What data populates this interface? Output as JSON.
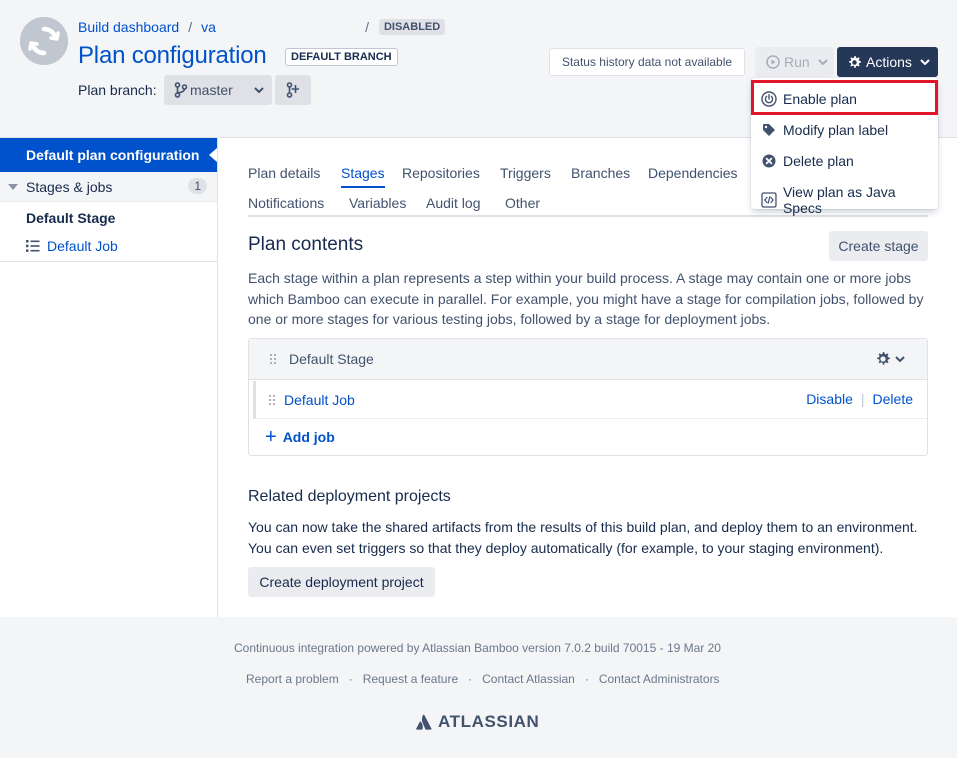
{
  "header": {
    "breadcrumb": [
      "Build dashboard",
      "va"
    ],
    "breadcrumb_sep": "/",
    "plan_status": "DISABLED",
    "title": "Plan configuration",
    "branch_badge": "DEFAULT BRANCH",
    "branch_label": "Plan branch:",
    "branch_value": "master",
    "status_history": "Status history data not available",
    "run_label": "Run",
    "actions_label": "Actions"
  },
  "actions_menu": {
    "items": [
      {
        "label": "Enable plan",
        "icon": "power-icon",
        "highlighted": true
      },
      {
        "label": "Modify plan label",
        "icon": "tag-icon"
      },
      {
        "label": "Delete plan",
        "icon": "x-circle-icon"
      },
      {
        "label": "View plan as Java Specs",
        "icon": "code-icon"
      }
    ],
    "highlight_color": "#e0152c"
  },
  "sidebar": {
    "active_item": "Default plan configuration",
    "group_label": "Stages & jobs",
    "group_count": "1",
    "stage_label": "Default Stage",
    "job_label": "Default Job"
  },
  "tabs": [
    {
      "label": "Plan details"
    },
    {
      "label": "Stages",
      "active": true
    },
    {
      "label": "Repositories"
    },
    {
      "label": "Triggers"
    },
    {
      "label": "Branches"
    },
    {
      "label": "Dependencies"
    },
    {
      "label": "Notifications"
    },
    {
      "label": "Variables"
    },
    {
      "label": "Audit log"
    },
    {
      "label": "Other"
    }
  ],
  "plan_contents": {
    "title": "Plan contents",
    "create_stage": "Create stage",
    "description": "Each stage within a plan represents a step within your build process. A stage may contain one or more jobs which Bamboo can execute in parallel. For example, you might have a stage for compilation jobs, followed by one or more stages for various testing jobs, followed by a stage for deployment jobs.",
    "stage_name": "Default Stage",
    "job_name": "Default Job",
    "disable_label": "Disable",
    "delete_label": "Delete",
    "add_job": "Add job"
  },
  "related": {
    "title": "Related deployment projects",
    "description": "You can now take the shared artifacts from the results of this build plan, and deploy them to an environment. You can even set triggers so that they deploy automatically (for example, to your staging environment).",
    "button": "Create deployment project"
  },
  "footer": {
    "powered_by": "Continuous integration powered by Atlassian Bamboo version 7.0.2 build 70015 - 19 Mar 20",
    "links": [
      "Report a problem",
      "Request a feature",
      "Contact Atlassian",
      "Contact Administrators"
    ],
    "link_sep": "·",
    "logo_text": "ATLASSIAN"
  },
  "colors": {
    "brand": "#0052cc",
    "actions_bg": "#253858"
  }
}
